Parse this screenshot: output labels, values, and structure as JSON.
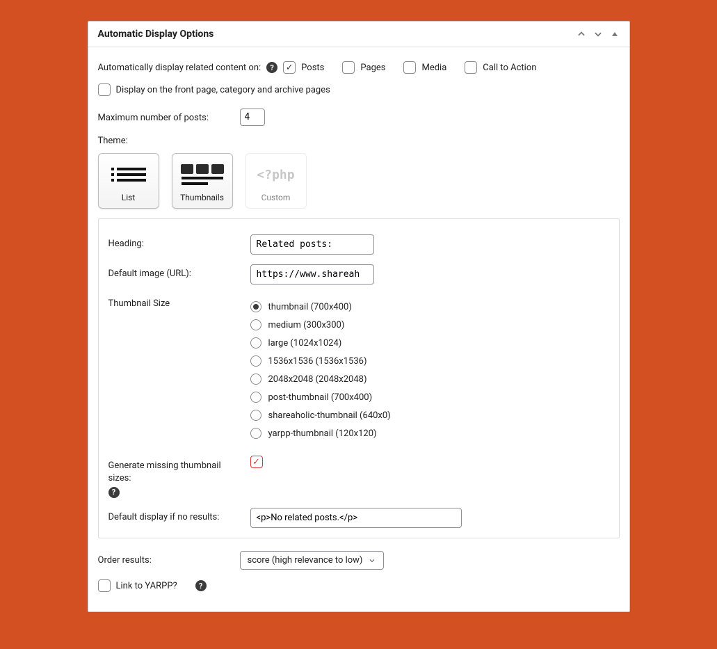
{
  "header": {
    "title": "Automatic Display Options"
  },
  "auto_display": {
    "label": "Automatically display related content on:",
    "opts": [
      {
        "label": "Posts",
        "checked": true
      },
      {
        "label": "Pages",
        "checked": false
      },
      {
        "label": "Media",
        "checked": false
      },
      {
        "label": "Call to Action",
        "checked": false
      }
    ]
  },
  "front_page": {
    "label": "Display on the front page, category and archive pages",
    "checked": false
  },
  "max_posts": {
    "label": "Maximum number of posts:",
    "value": "4"
  },
  "theme": {
    "label": "Theme:",
    "options": [
      "List",
      "Thumbnails",
      "Custom"
    ],
    "custom_icon": "<?php"
  },
  "box": {
    "heading": {
      "label": "Heading:",
      "value": "Related posts:"
    },
    "default_image": {
      "label": "Default image (URL):",
      "value": "https://www.shareah"
    },
    "thumb_size": {
      "label": "Thumbnail Size",
      "items": [
        "thumbnail (700x400)",
        "medium (300x300)",
        "large (1024x1024)",
        "1536x1536 (1536x1536)",
        "2048x2048 (2048x2048)",
        "post-thumbnail (700x400)",
        "shareaholic-thumbnail (640x0)",
        "yarpp-thumbnail (120x120)"
      ],
      "selected": 0
    },
    "generate": {
      "label": "Generate missing thumbnail sizes:",
      "checked": true
    },
    "no_results": {
      "label": "Default display if no results:",
      "value": "<p>No related posts.</p>"
    }
  },
  "order": {
    "label": "Order results:",
    "value": "score (high relevance to low)"
  },
  "link_yarpp": {
    "label": "Link to YARPP?",
    "checked": false
  }
}
